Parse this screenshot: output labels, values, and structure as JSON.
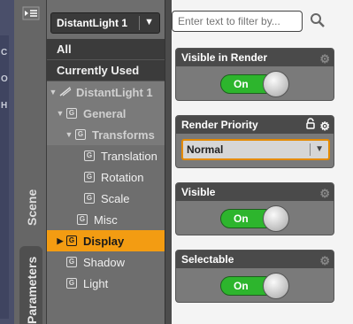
{
  "node_selector": {
    "value": "DistantLight 1",
    "arrow": "▼"
  },
  "vertical_tabs": {
    "scene": "Scene",
    "parameters": "Parameters"
  },
  "left_edge": {
    "glyphs": [
      "C",
      "O",
      "H"
    ]
  },
  "tree": {
    "all": "All",
    "currently_used": "Currently Used",
    "root": "DistantLight 1",
    "general": "General",
    "transforms": "Transforms",
    "translation": "Translation",
    "rotation": "Rotation",
    "scale": "Scale",
    "misc": "Misc",
    "display": "Display",
    "shadow": "Shadow",
    "light": "Light"
  },
  "filter": {
    "placeholder": "Enter text to filter by..."
  },
  "properties": [
    {
      "title": "Visible in Render",
      "toggle_label": "On"
    },
    {
      "title": "Render Priority",
      "value": "Normal"
    },
    {
      "title": "Visible",
      "toggle_label": "On"
    },
    {
      "title": "Selectable",
      "toggle_label": "On"
    }
  ],
  "colors": {
    "accent": "#f39c12",
    "toggle_on": "#2db52d"
  }
}
